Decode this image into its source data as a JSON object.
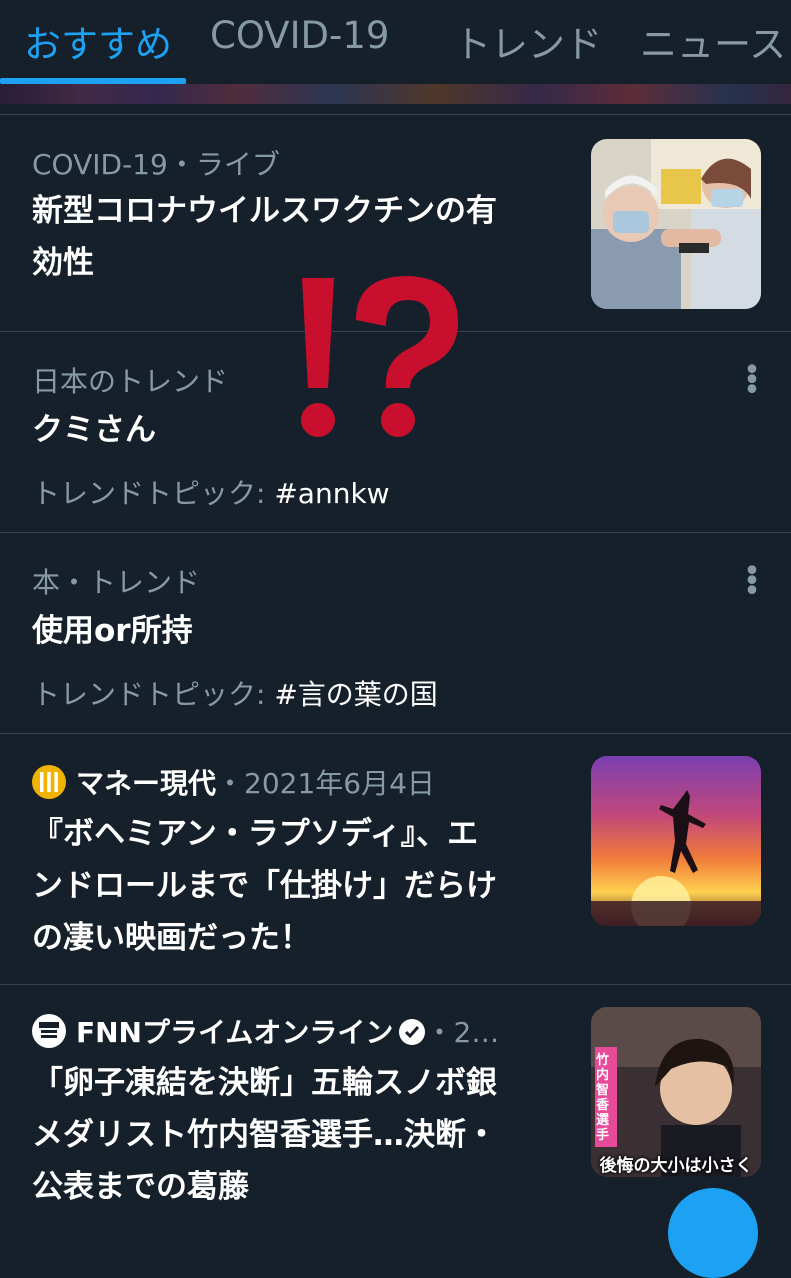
{
  "tabs": [
    {
      "label": "おすすめ",
      "active": true
    },
    {
      "label": "COVID-19",
      "active": false
    },
    {
      "label": "トレンド",
      "active": false
    },
    {
      "label": "ニュース",
      "active": false
    }
  ],
  "overlay_mark": "!?",
  "cards": [
    {
      "category": "COVID-19",
      "separator": "・",
      "status": "ライブ",
      "title_lines": [
        "新型コロナウイルスワクチンの有",
        "効性"
      ],
      "thumbnail": "vaccine-photo"
    },
    {
      "category": "日本のトレンド",
      "title": "クミさん",
      "topic_prefix": "トレンドトピック: ",
      "topic_tag": "#annkw"
    },
    {
      "category": "本・トレンド",
      "title": "使用or所持",
      "topic_prefix": "トレンドトピック: ",
      "topic_tag": "#言の葉の国"
    },
    {
      "source": "マネー現代",
      "separator": "・",
      "date": "2021年6月4日",
      "title_lines": [
        "『ボヘミアン・ラプソディ』、エ",
        "ンドロールまで「仕掛け」だらけ",
        "の凄い映画だった！"
      ],
      "thumbnail": "concert-silhouette-photo"
    },
    {
      "source": "FNNプライムオンライン",
      "separator": "・",
      "date": "2…",
      "title_lines": [
        "「卵子凍結を決断」五輪スノボ銀",
        "メダリスト竹内智香選手…決断・",
        "公表までの葛藤"
      ],
      "thumbnail": "interview-photo",
      "thumbnail_caption": "後悔の大小は小さく",
      "thumbnail_side_caption": "竹内智香選手"
    }
  ],
  "colors": {
    "background": "#15202b",
    "accent": "#1da1f2",
    "secondary_text": "#8899a6",
    "divider": "#38444d",
    "overlay_red": "#c8102e"
  }
}
